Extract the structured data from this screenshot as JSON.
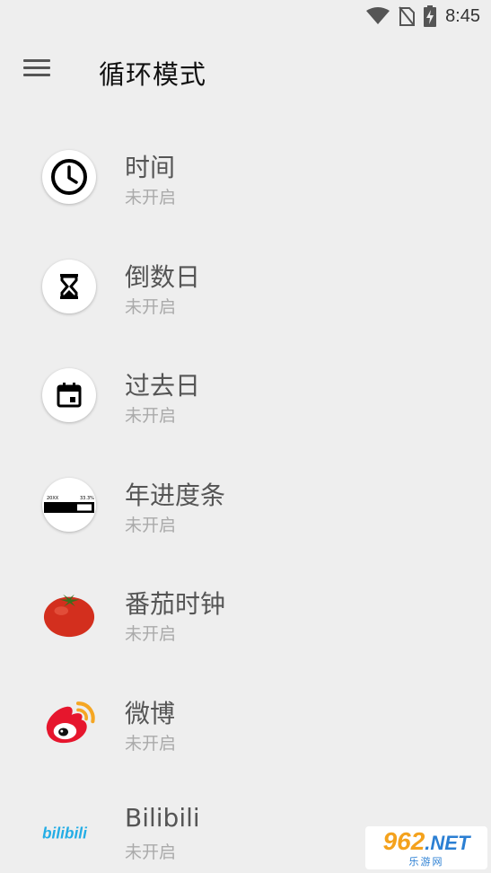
{
  "status_bar": {
    "time": "8:45",
    "icons": [
      "wifi-icon",
      "no-sim-icon",
      "battery-charging-icon"
    ]
  },
  "app_bar": {
    "title": "循环模式",
    "menu_icon": "hamburger-menu-icon"
  },
  "items": [
    {
      "title": "时间",
      "status": "未开启",
      "icon": "clock-icon"
    },
    {
      "title": "倒数日",
      "status": "未开启",
      "icon": "hourglass-icon"
    },
    {
      "title": "过去日",
      "status": "未开启",
      "icon": "calendar-icon"
    },
    {
      "title": "年进度条",
      "status": "未开启",
      "icon": "progress-bar-icon",
      "icon_text_left": "20XX",
      "icon_text_right": "33.3%"
    },
    {
      "title": "番茄时钟",
      "status": "未开启",
      "icon": "tomato-icon"
    },
    {
      "title": "微博",
      "status": "未开启",
      "icon": "weibo-icon"
    },
    {
      "title": "Bilibili",
      "status": "未开启",
      "icon": "bilibili-icon",
      "icon_text": "bilibili"
    }
  ],
  "watermark": {
    "logo_num": "962",
    "logo_net": ".NET",
    "sub": "乐游网"
  },
  "colors": {
    "background": "#eeeeee",
    "title_text": "#555555",
    "status_text": "#aaaaaa",
    "tomato": "#d32f1e",
    "weibo_red": "#e6162d",
    "weibo_orange": "#f5a623",
    "bilibili_blue": "#23ade5"
  }
}
